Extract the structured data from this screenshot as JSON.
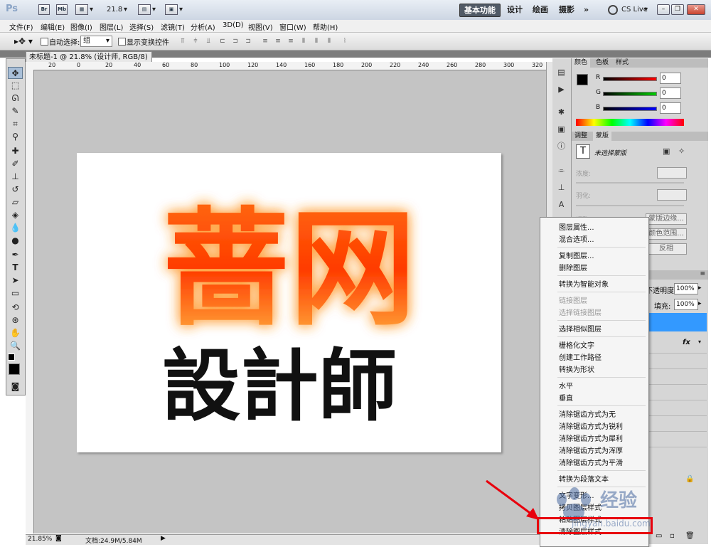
{
  "titlebar": {
    "app_logo": "Ps",
    "bridge_icon": "Br",
    "mini_bridge_icon": "Mb",
    "zoom_value": "21.8",
    "workspaces": [
      "基本功能",
      "设计",
      "绘画",
      "摄影"
    ],
    "more": "»",
    "cs_live": "CS Live"
  },
  "menubar": [
    "文件(F)",
    "编辑(E)",
    "图像(I)",
    "图层(L)",
    "选择(S)",
    "滤镜(T)",
    "分析(A)",
    "3D(D)",
    "视图(V)",
    "窗口(W)",
    "帮助(H)"
  ],
  "options": {
    "auto_select_label": "自动选择:",
    "auto_select_value": "组",
    "show_transform_label": "显示变换控件"
  },
  "document": {
    "tab_title": "未标题-1 @ 21.8% (设计师, RGB/8) *",
    "zoom_status": "21.85%",
    "doc_status": "文档:24.9M/5.84M",
    "ruler_top_labels": [
      "20",
      "0",
      "20",
      "40",
      "60",
      "80",
      "100",
      "120",
      "140",
      "160",
      "180",
      "200",
      "220",
      "240",
      "260",
      "280",
      "300",
      "320"
    ]
  },
  "artwork": {
    "line1": "蔷网",
    "line2": "設計師"
  },
  "color_panel": {
    "tabs": [
      "颜色",
      "色板",
      "样式"
    ],
    "channels": [
      {
        "label": "R",
        "value": "0",
        "color": "#cc0000"
      },
      {
        "label": "G",
        "value": "0",
        "color": "#00aa00"
      },
      {
        "label": "B",
        "value": "0",
        "color": "#0000cc"
      }
    ]
  },
  "adjust_panel": {
    "tabs": [
      "调整",
      "蒙版"
    ],
    "no_selection": "未选择蒙版",
    "density_label": "浓度:",
    "feather_label": "羽化:",
    "refine_label": "调整:",
    "mask_edge": "蒙版边缘...",
    "color_range": "颜色范围...",
    "invert": "反相"
  },
  "layers_panel": {
    "opacity_label": "不透明度:",
    "opacity_value": "100%",
    "fill_label": "填充:",
    "fill_value": "100%",
    "fx_label": "fx"
  },
  "context_menu": {
    "items": [
      {
        "label": "图层属性...",
        "disabled": false
      },
      {
        "label": "混合选项...",
        "disabled": false
      },
      {
        "sep": true
      },
      {
        "label": "复制图层...",
        "disabled": false
      },
      {
        "label": "删除图层",
        "disabled": false
      },
      {
        "sep": true
      },
      {
        "label": "转换为智能对象",
        "disabled": false
      },
      {
        "sep": true
      },
      {
        "label": "链接图层",
        "disabled": true
      },
      {
        "label": "选择链接图层",
        "disabled": true
      },
      {
        "sep": true
      },
      {
        "label": "选择相似图层",
        "disabled": false
      },
      {
        "sep": true
      },
      {
        "label": "栅格化文字",
        "disabled": false
      },
      {
        "label": "创建工作路径",
        "disabled": false
      },
      {
        "label": "转换为形状",
        "disabled": false
      },
      {
        "sep": true
      },
      {
        "label": "水平",
        "disabled": false
      },
      {
        "label": "垂直",
        "disabled": false
      },
      {
        "sep": true
      },
      {
        "label": "消除锯齿方式为无",
        "disabled": false
      },
      {
        "label": "消除锯齿方式为锐利",
        "disabled": false
      },
      {
        "label": "消除锯齿方式为犀利",
        "disabled": false
      },
      {
        "label": "消除锯齿方式为浑厚",
        "disabled": false
      },
      {
        "label": "消除锯齿方式为平滑",
        "disabled": false
      },
      {
        "sep": true
      },
      {
        "label": "转换为段落文本",
        "disabled": false
      },
      {
        "sep": true
      },
      {
        "label": "文字变形...",
        "disabled": false
      },
      {
        "label": "拷贝图层样式",
        "disabled": false
      },
      {
        "label": "粘贴图层样式",
        "disabled": false
      },
      {
        "label": "清除图层样式",
        "disabled": false
      }
    ]
  },
  "watermark": {
    "brand": "经验",
    "url": "jingyan.baidu.com"
  },
  "accent": {
    "highlight": "#e8000d",
    "selection": "#3399ff"
  }
}
